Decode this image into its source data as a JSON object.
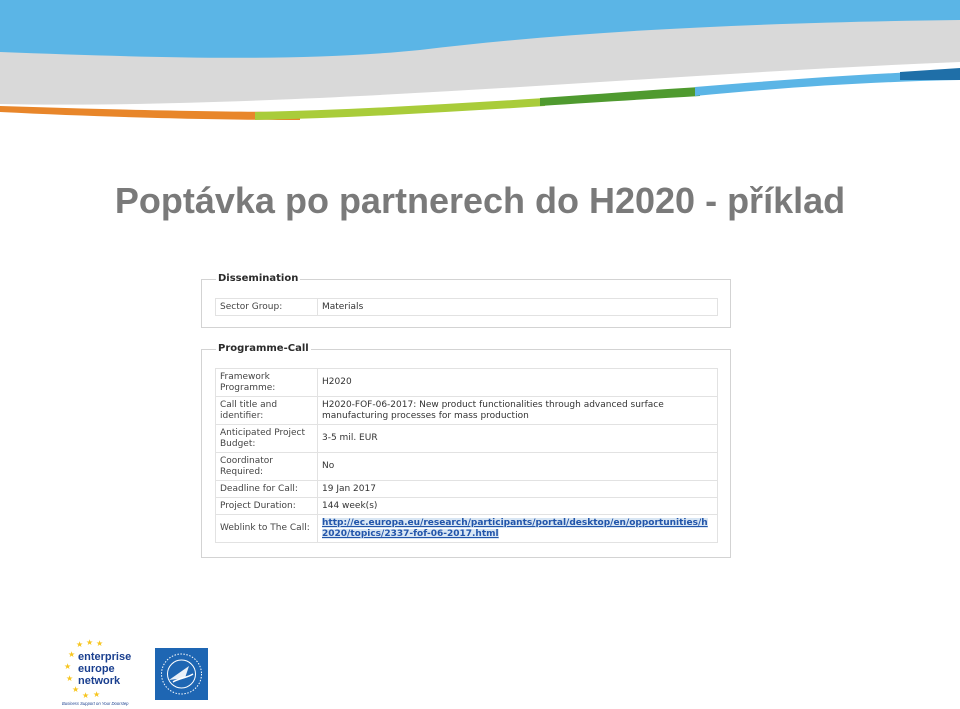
{
  "title": "Poptávka po partnerech do H2020 - příklad",
  "dissemination": {
    "legend": "Dissemination",
    "rows": [
      {
        "label": "Sector Group:",
        "value": "Materials"
      }
    ]
  },
  "programme_call": {
    "legend": "Programme-Call",
    "rows": [
      {
        "label": "Framework Programme:",
        "value": "H2020"
      },
      {
        "label": "Call title and identifier:",
        "value": "H2020-FOF-06-2017: New product functionalities through advanced surface manufacturing processes for mass production"
      },
      {
        "label": "Anticipated Project Budget:",
        "value": "3-5 mil. EUR"
      },
      {
        "label": "Coordinator Required:",
        "value": "No"
      },
      {
        "label": "Deadline for Call:",
        "value": "19 Jan 2017"
      },
      {
        "label": "Project Duration:",
        "value": "144 week(s)"
      },
      {
        "label": "Weblink to The Call:",
        "value": "http://ec.europa.eu/research/participants/portal/desktop/en/opportunities/h2020/topics/2337-fof-06-2017.html"
      }
    ]
  },
  "logos": {
    "een_line1": "enterprise",
    "een_line2": "europe",
    "een_line3": "network",
    "een_tagline": "Business Support on Your Doorstep"
  },
  "colors": {
    "title": "#7a7a7a",
    "band_blue": "#5bb5e6",
    "band_gray": "#d9d9d9",
    "band_orange": "#e8862a",
    "band_green": "#7dbf3c",
    "band_darkblue": "#1f6fa8",
    "link": "#2255aa",
    "een_blue": "#1a3f8f",
    "star_yellow": "#f7c51e",
    "btc_blue": "#1e66b3"
  }
}
